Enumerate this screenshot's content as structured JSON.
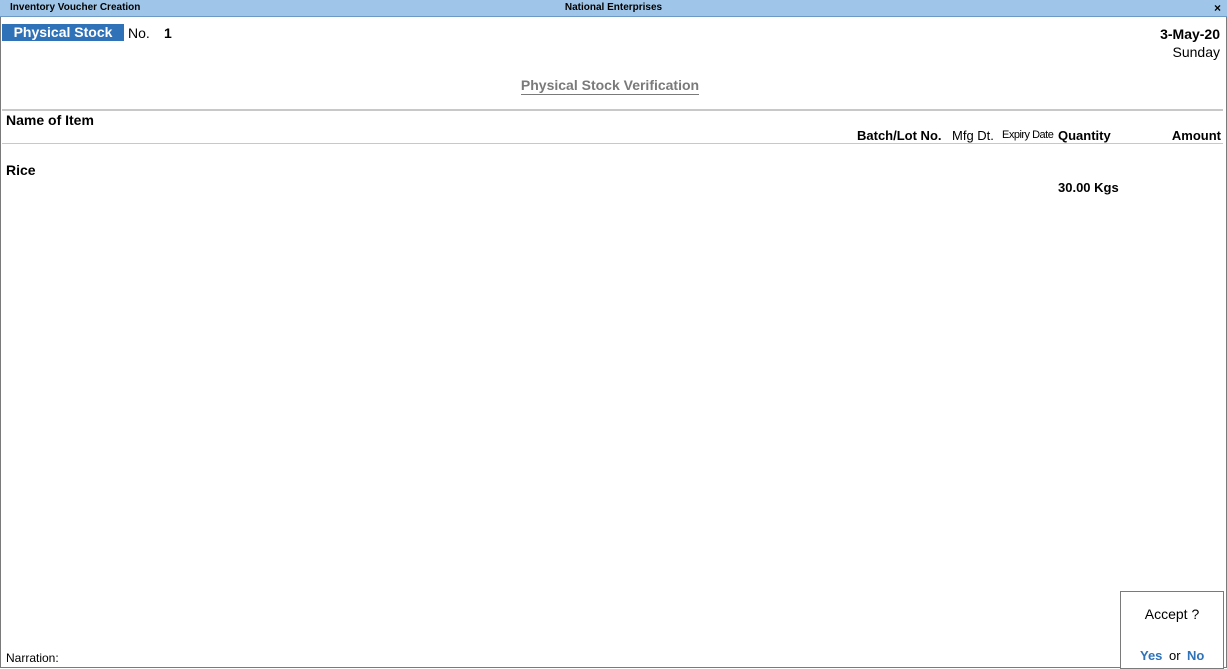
{
  "titlebar": {
    "left": "Inventory Voucher Creation",
    "center": "National Enterprises",
    "close": "×"
  },
  "voucher": {
    "type": "Physical Stock",
    "no_label": "No.",
    "no_value": "1",
    "date": "3-May-20",
    "day": "Sunday",
    "heading": "Physical Stock Verification"
  },
  "columns": {
    "name": "Name of Item",
    "batch": "Batch/Lot No.",
    "mfg": "Mfg Dt.",
    "expiry": "Expiry Date",
    "quantity": "Quantity",
    "amount": "Amount"
  },
  "items": [
    {
      "name": "Rice",
      "quantity": "30.00 Kgs"
    }
  ],
  "narration_label": "Narration:",
  "accept": {
    "question": "Accept ?",
    "yes": "Yes",
    "or": "or",
    "no": "No"
  },
  "colors": {
    "titlebar": "#9fc6e8",
    "accent": "#2f72b8"
  }
}
